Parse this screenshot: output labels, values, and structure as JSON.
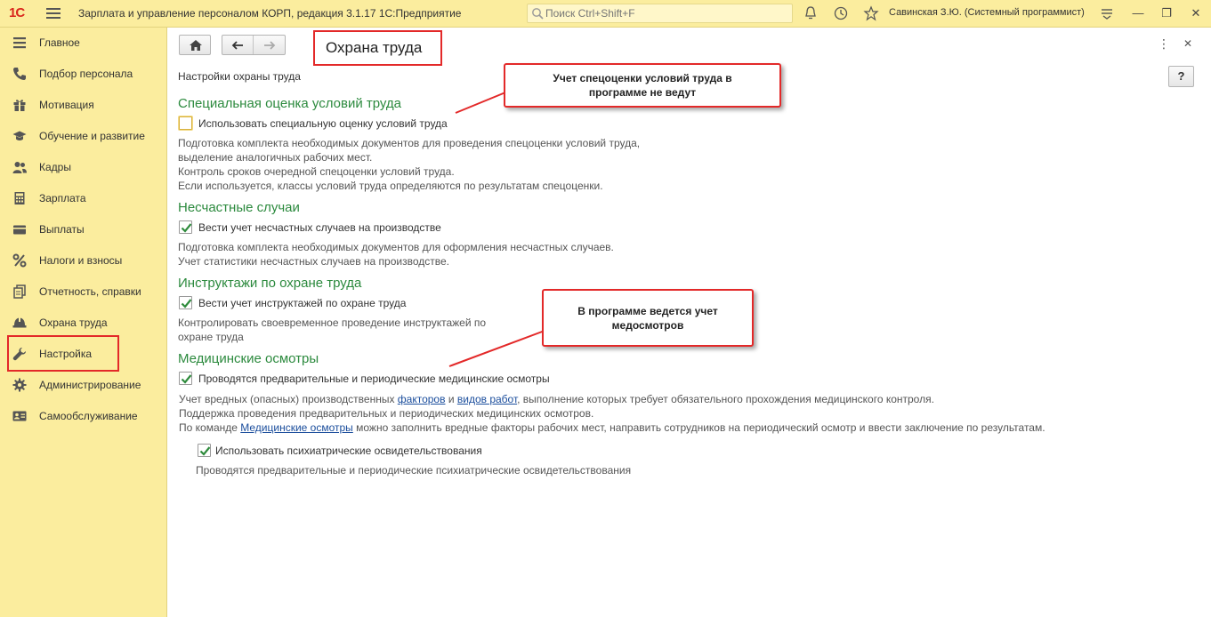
{
  "titlebar": {
    "logo": "1С",
    "app_title": "Зарплата и управление персоналом КОРП, редакция 3.1.17 1С:Предприятие",
    "search_placeholder": "Поиск Ctrl+Shift+F",
    "user": "Савинская З.Ю. (Системный программист)"
  },
  "sidebar": {
    "items": [
      {
        "label": "Главное",
        "icon": "menu-icon"
      },
      {
        "label": "Подбор персонала",
        "icon": "phone-icon"
      },
      {
        "label": "Мотивация",
        "icon": "gift-icon"
      },
      {
        "label": "Обучение и развитие",
        "icon": "graduation-cap-icon"
      },
      {
        "label": "Кадры",
        "icon": "people-icon"
      },
      {
        "label": "Зарплата",
        "icon": "calculator-icon"
      },
      {
        "label": "Выплаты",
        "icon": "wallet-icon"
      },
      {
        "label": "Налоги и взносы",
        "icon": "percent-icon"
      },
      {
        "label": "Отчетность, справки",
        "icon": "documents-icon"
      },
      {
        "label": "Охрана труда",
        "icon": "helmet-icon"
      },
      {
        "label": "Настройка",
        "icon": "wrench-icon"
      },
      {
        "label": "Администрирование",
        "icon": "gear-icon"
      },
      {
        "label": "Самообслуживание",
        "icon": "id-card-icon"
      }
    ],
    "selected": "Настройка"
  },
  "page": {
    "title": "Охрана труда",
    "subtitle": "Настройки охраны труда",
    "help": "?"
  },
  "sections": {
    "special": {
      "title": "Специальная оценка условий труда",
      "checkbox_label": "Использовать специальную оценку условий труда",
      "checked": false,
      "desc": [
        "Подготовка комплекта необходимых документов для проведения спецоценки условий труда,",
        "выделение аналогичных рабочих мест.",
        "Контроль сроков очередной спецоценки условий труда.",
        "Если используется, классы условий труда определяются по результатам спецоценки."
      ]
    },
    "accidents": {
      "title": "Несчастные случаи",
      "checkbox_label": "Вести учет несчастных случаев на производстве",
      "checked": true,
      "desc": [
        "Подготовка комплекта необходимых документов для оформления несчастных случаев.",
        "Учет статистики несчастных случаев на производстве."
      ]
    },
    "briefings": {
      "title": "Инструктажи по охране труда",
      "checkbox_label": "Вести учет инструктажей по охране труда",
      "checked": true,
      "desc": [
        "Контролировать своевременное проведение инструктажей по",
        "охране труда"
      ]
    },
    "medical": {
      "title": "Медицинские осмотры",
      "checkbox_label": "Проводятся предварительные и периодические медицинские осмотры",
      "checked": true,
      "line1_a": "Учет вредных (опасных) производственных ",
      "line1_link1": "факторов",
      "line1_b": " и ",
      "line1_link2": "видов работ",
      "line1_c": ", выполнение которых требует обязательного прохождения медицинского контроля.",
      "line2": "Поддержка проведения предварительных и периодических медицинских осмотров.",
      "line3_a": "По команде ",
      "line3_link": "Медицинские осмотры",
      "line3_b": " можно заполнить вредные факторы рабочих мест, направить сотрудников на периодический осмотр и ввести заключение по результатам.",
      "psych_label": "Использовать психиатрические освидетельствования",
      "psych_checked": true,
      "psych_desc": "Проводятся предварительные и периодические психиатрические освидетельствования"
    }
  },
  "callouts": {
    "top": [
      "Учет спецоценки условий труда в",
      "программе не ведут"
    ],
    "bottom": [
      "В программе ведется учет",
      "медосмотров"
    ]
  },
  "colors": {
    "panel": "#fbed9e",
    "section_title": "#2c8a3e",
    "highlight": "#e32929",
    "check": "#2e8b3c",
    "link": "#1a4d9c"
  }
}
